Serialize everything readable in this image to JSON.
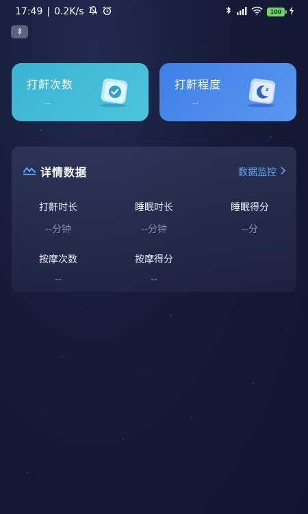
{
  "status_bar": {
    "time": "17:49",
    "network_speed": "0.2K/s",
    "battery": "100",
    "left_icons": [
      "mute-bell-icon",
      "alarm-icon"
    ],
    "right_icons": [
      "bluetooth-icon",
      "signal-icon",
      "wifi-icon",
      "battery-icon",
      "charging-icon"
    ]
  },
  "bluetooth_badge": {
    "icon": "bluetooth-icon"
  },
  "cards": [
    {
      "title": "打鼾次数",
      "value": "--",
      "icon": "clock-check-icon",
      "color": "#3ab3d4"
    },
    {
      "title": "打鼾程度",
      "value": "--",
      "icon": "moon-sleep-icon",
      "color": "#3f80e6"
    }
  ],
  "details": {
    "title": "详情数据",
    "link_label": "数据监控",
    "icon": "chart-line-icon",
    "stats": [
      {
        "label": "打鼾时长",
        "value": "--分钟"
      },
      {
        "label": "睡眠时长",
        "value": "--分钟"
      },
      {
        "label": "睡眠得分",
        "value": "--分"
      },
      {
        "label": "按摩次数",
        "value": "--"
      },
      {
        "label": "按摩得分",
        "value": "--"
      }
    ]
  },
  "colors": {
    "background": "#161b38",
    "accent_link": "#5fa8f5",
    "card_cyan": "#3ab3d4",
    "card_blue": "#3f80e6"
  }
}
